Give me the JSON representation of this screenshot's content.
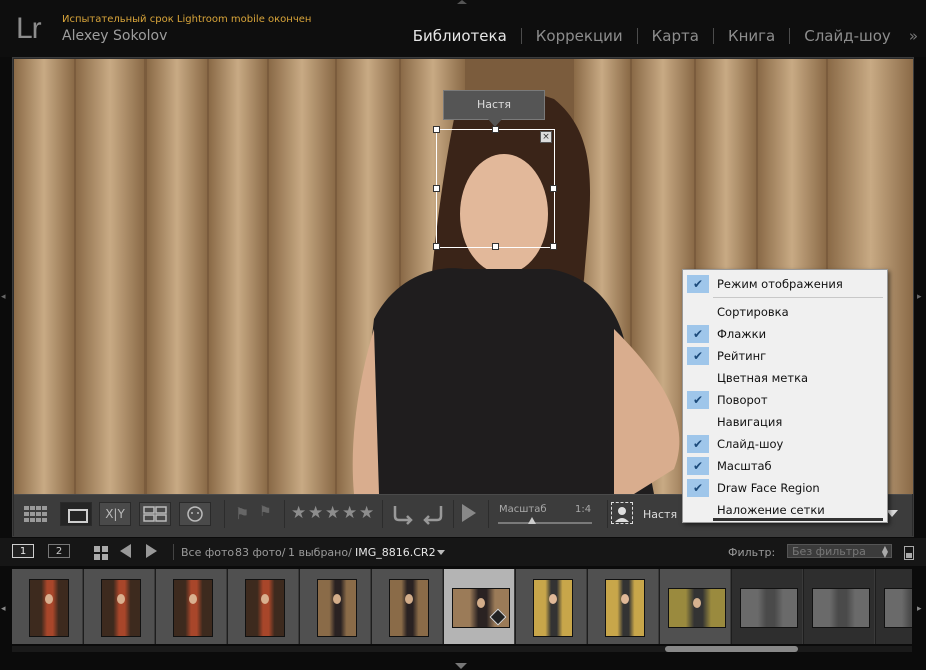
{
  "header": {
    "logo": "Lr",
    "trial_notice": "Испытательный срок Lightroom mobile окончен",
    "user_name": "Alexey Sokolov",
    "modules": [
      "Библиотека",
      "Коррекции",
      "Карта",
      "Книга",
      "Слайд-шоу"
    ],
    "active_module": "Библиотека",
    "more_glyph": "»"
  },
  "photo": {
    "face_tag_label": "Настя"
  },
  "toolbar": {
    "view_grid_icon": "grid-view-icon",
    "view_loupe_icon": "loupe-view-icon",
    "view_compare_label": "X|Y",
    "view_survey_icon": "survey-view-icon",
    "view_people_icon": "people-view-icon",
    "rating_stars": 5,
    "scale_label": "Масштаб",
    "scale_value": "1:4",
    "scale_slider_fraction": 0.33,
    "person_name": "Настя"
  },
  "context_menu": {
    "items": [
      {
        "label": "Режим отображения",
        "checked": true
      },
      {
        "label": "Сортировка",
        "checked": false
      },
      {
        "label": "Флажки",
        "checked": true
      },
      {
        "label": "Рейтинг",
        "checked": true
      },
      {
        "label": "Цветная метка",
        "checked": false
      },
      {
        "label": "Поворот",
        "checked": true
      },
      {
        "label": "Навигация",
        "checked": false
      },
      {
        "label": "Слайд-шоу",
        "checked": true
      },
      {
        "label": "Масштаб",
        "checked": true
      },
      {
        "label": "Draw Face Region",
        "checked": true
      },
      {
        "label": "Наложение сетки",
        "checked": false
      }
    ],
    "accent": "#9fc6ea"
  },
  "filmstrip_header": {
    "screen1": "1",
    "screen2": "2",
    "source": "Все фото",
    "count": "83 фото/",
    "selected": "1 выбрано/",
    "filename": "IMG_8816.CR2",
    "filter_label": "Фильтр:",
    "filter_value": "Без фильтра"
  },
  "filmstrip": {
    "thumbnails": [
      {
        "kind": "portrait-red"
      },
      {
        "kind": "portrait-red"
      },
      {
        "kind": "portrait-red"
      },
      {
        "kind": "portrait-red"
      },
      {
        "kind": "portrait-wood"
      },
      {
        "kind": "portrait-wood"
      },
      {
        "kind": "landscape-wood",
        "selected": true
      },
      {
        "kind": "portrait-yellow"
      },
      {
        "kind": "portrait-yellow"
      },
      {
        "kind": "landscape-yellow"
      },
      {
        "kind": "landscape-grey",
        "dim": true
      },
      {
        "kind": "landscape-grey",
        "dim": true
      },
      {
        "kind": "landscape-grey",
        "dim": true
      }
    ]
  }
}
